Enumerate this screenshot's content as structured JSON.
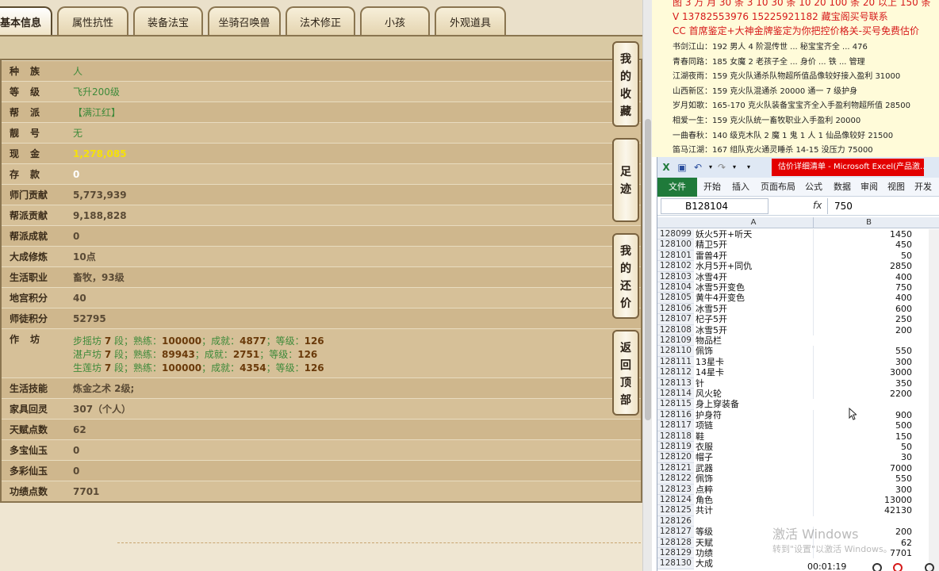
{
  "tabs": [
    {
      "label": "基本信息",
      "active": true
    },
    {
      "label": "属性抗性"
    },
    {
      "label": "装备法宝"
    },
    {
      "label": "坐骑召唤兽"
    },
    {
      "label": "法术修正"
    },
    {
      "label": "小孩"
    },
    {
      "label": "外观道具"
    }
  ],
  "info": {
    "race": {
      "label": "种族",
      "value": "人"
    },
    "level": {
      "label": "等级",
      "value": "飞升200级"
    },
    "guild": {
      "label": "帮派",
      "value": "【满江红】"
    },
    "pretty_id": {
      "label": "靓号",
      "value": "无"
    },
    "cash": {
      "label": "现金",
      "value": "1,278,085"
    },
    "deposit": {
      "label": "存款",
      "value": "0"
    },
    "master_contrib": {
      "label": "师门贡献",
      "value": "5,773,939"
    },
    "guild_contrib": {
      "label": "帮派贡献",
      "value": "9,188,828"
    },
    "guild_achieve": {
      "label": "帮派成就",
      "value": "0"
    },
    "dacheng": {
      "label": "大成修炼",
      "value": "10点"
    },
    "career": {
      "label": "生活职业",
      "value": "畜牧，93级"
    },
    "dungeon_points": {
      "label": "地宫积分",
      "value": "40"
    },
    "mentor_points": {
      "label": "师徒积分",
      "value": "52795"
    },
    "workshop": {
      "label": "作坊",
      "lines": [
        {
          "name": "步摇坊",
          "rank": "7",
          "skill": "100000",
          "achieve": "4877",
          "grade": "126"
        },
        {
          "name": "湛卢坊",
          "rank": "7",
          "skill": "89943",
          "achieve": "2751",
          "grade": "126"
        },
        {
          "name": "生莲坊",
          "rank": "7",
          "skill": "100000",
          "achieve": "4354",
          "grade": "126"
        }
      ],
      "t_duan": "段；熟练：",
      "t_achieve": "；成就：",
      "t_grade": "；等级："
    },
    "life_skill": {
      "label": "生活技能",
      "value": "炼金之术 2级;"
    },
    "home_spirit": {
      "label": "家具回灵",
      "value": "307（个人）"
    },
    "talent": {
      "label": "天赋点数",
      "value": "62"
    },
    "duobao": {
      "label": "多宝仙玉",
      "value": "0"
    },
    "duocai": {
      "label": "多彩仙玉",
      "value": "0"
    },
    "merit": {
      "label": "功绩点数",
      "value": "7701"
    }
  },
  "side_buttons": [
    {
      "label": [
        "我",
        "的",
        "收",
        "藏"
      ]
    },
    {
      "label": [
        "足",
        "迹"
      ]
    },
    {
      "label": [
        "我",
        "的",
        "还",
        "价"
      ]
    },
    {
      "label": [
        "返",
        "回",
        "顶",
        "部"
      ]
    }
  ],
  "notes": {
    "cut_line": "图 3 万 月 30 条  3 10 30 条  10 20 100 条  20 以上 150 条",
    "phone_line": "V 13782553976    15225921182  藏宝阁买号联系",
    "cc_line": "CC 首席鉴定+大神金牌鉴定为你把控价格关-买号免费估价",
    "entries": [
      "书剑江山：192 男人 4 阶混传世 ... 秘宝宝齐全 ... 476",
      "青春同路：185 女魔 2 老孩子全 ... 身价 ... 铁 ... 管理",
      "江湖夜雨：159 克火队通杀队物超所值品像较好接入盈利 31000",
      "山西新区：159 克火队混通杀 20000 通一 7 级护身",
      "岁月如歌：165-170 克火队装备宝宝齐全入手盈利物超所值 28500",
      "相爱一生：159 克火队统一畜牧职业入手盈利 20000",
      "一曲春秋：140 级克木队 2 魔 1 鬼 1 人 1 仙品像较好 21500",
      "笛马江湖：167 组队克火通灵睡杀 14-15 没压力 75000"
    ]
  },
  "excel": {
    "title": "估价详细清单 - Microsoft Excel(产品激...",
    "ribbon_tabs": [
      "文件",
      "开始",
      "插入",
      "页面布局",
      "公式",
      "数据",
      "审阅",
      "视图",
      "开发工"
    ],
    "name_box": "B128104",
    "fx": "fx",
    "formula": "750",
    "col_a": "A",
    "col_b": "B",
    "rows": [
      [
        "128099",
        "妖火5开+听天",
        "1450"
      ],
      [
        "128100",
        "精卫5开",
        "450"
      ],
      [
        "128101",
        "雷兽4开",
        "50"
      ],
      [
        "128102",
        "水月5开+同仇",
        "2850"
      ],
      [
        "128103",
        "冰雪4开",
        "400"
      ],
      [
        "128104",
        "冰雪5开变色",
        "750"
      ],
      [
        "128105",
        "黄牛4开变色",
        "400"
      ],
      [
        "128106",
        "冰雪5开",
        "600"
      ],
      [
        "128107",
        "杞子5开",
        "250"
      ],
      [
        "128108",
        "冰雪5开",
        "200"
      ],
      [
        "128109",
        "物品栏",
        ""
      ],
      [
        "128110",
        "佩饰",
        "550"
      ],
      [
        "128111",
        "13星卡",
        "300"
      ],
      [
        "128112",
        "14星卡",
        "3000"
      ],
      [
        "128113",
        "针",
        "350"
      ],
      [
        "128114",
        "风火轮",
        "2200"
      ],
      [
        "128115",
        "身上穿装备",
        ""
      ],
      [
        "128116",
        "护身符",
        "900"
      ],
      [
        "128117",
        "项链",
        "500"
      ],
      [
        "128118",
        "鞋",
        "150"
      ],
      [
        "128119",
        "衣服",
        "50"
      ],
      [
        "128120",
        "帽子",
        "30"
      ],
      [
        "128121",
        "武器",
        "7000"
      ],
      [
        "128122",
        "佩饰",
        "550"
      ],
      [
        "128123",
        "点粹",
        "300"
      ],
      [
        "128124",
        "角色",
        "13000"
      ],
      [
        "128125",
        "共计",
        "42130"
      ],
      [
        "128126",
        "",
        ""
      ],
      [
        "128127",
        "等级",
        "200"
      ],
      [
        "128128",
        "天赋",
        "62"
      ],
      [
        "128129",
        "功绩",
        "7701"
      ],
      [
        "128130",
        "大成",
        ""
      ]
    ]
  },
  "overlay": {
    "watermark_title": "激活 Windows",
    "watermark_sub": "转到\"设置\"以激活 Windows。",
    "timer": "00:01:19"
  }
}
